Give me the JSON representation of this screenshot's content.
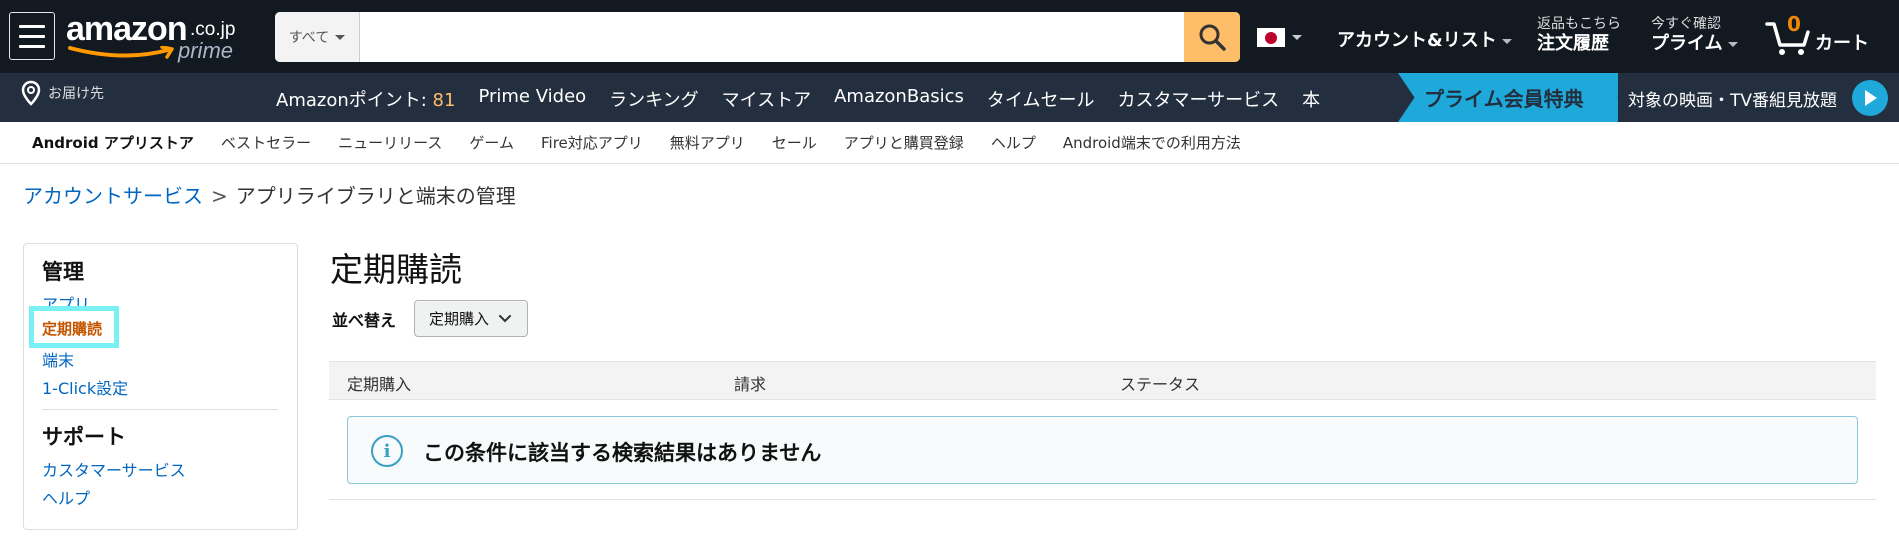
{
  "header": {
    "logo_brand": "amazon",
    "logo_tld": ".co.jp",
    "logo_sub": "prime",
    "search_category": "すべて",
    "search_placeholder": "",
    "account_label": "アカウント&リスト",
    "orders_small": "返品もこちら",
    "orders_big": "注文履歴",
    "prime_small": "今すぐ確認",
    "prime_big": "プライム",
    "cart_count": "0",
    "cart_label": "カート"
  },
  "main_nav": {
    "deliver_label": "お届け先",
    "points_label": "Amazonポイント: ",
    "points_value": "81",
    "items": [
      "Prime Video",
      "ランキング",
      "マイストア",
      "AmazonBasics",
      "タイムセール",
      "カスタマーサービス",
      "本"
    ],
    "banner_left": "プライム会員特典",
    "banner_right": "対象の映画・TV番組見放題"
  },
  "sub_nav": {
    "items": [
      "Android アプリストア",
      "ベストセラー",
      "ニューリリース",
      "ゲーム",
      "Fire対応アプリ",
      "無料アプリ",
      "セール",
      "アプリと購買登録",
      "ヘルプ",
      "Android端末での利用方法"
    ]
  },
  "breadcrumb": {
    "parent": "アカウントサービス",
    "separator": ">",
    "current": "アプリライブラリと端末の管理"
  },
  "sidebar": {
    "manage_heading": "管理",
    "manage_items": [
      "アプリ",
      "定期購読",
      "端末",
      "1-Click設定"
    ],
    "active_item": "定期購読",
    "support_heading": "サポート",
    "support_items": [
      "カスタマーサービス",
      "ヘルプ"
    ]
  },
  "content": {
    "title": "定期購読",
    "sort_label": "並べ替え",
    "sort_value": "定期購入",
    "columns": [
      "定期購入",
      "請求",
      "ステータス"
    ],
    "empty_message": "この条件に該当する検索結果はありません"
  },
  "colors": {
    "nav_bg": "#131921",
    "subnav_bg": "#232f3e",
    "search_button": "#febd69",
    "link": "#0066c0",
    "active": "#c45500",
    "highlight": "#79f0f4",
    "prime_blue": "#1fa9db"
  }
}
